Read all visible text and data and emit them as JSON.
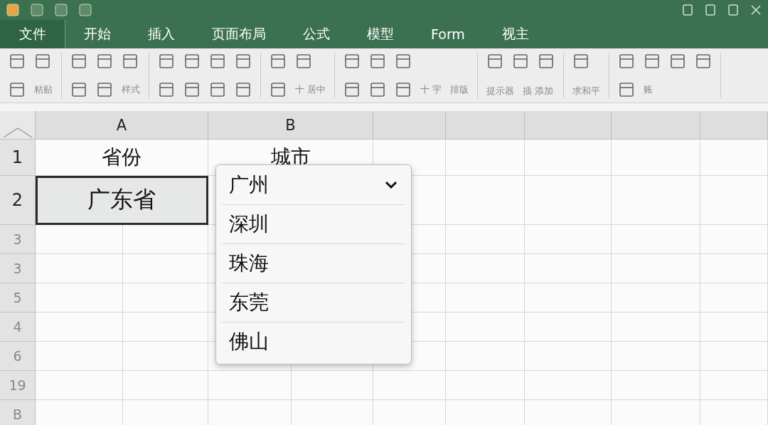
{
  "menu_tabs": [
    {
      "label": "文件",
      "selected": true
    },
    {
      "label": "开始",
      "selected": false
    },
    {
      "label": "插入",
      "selected": false
    },
    {
      "label": "页面布局",
      "selected": false
    },
    {
      "label": "公式",
      "selected": false
    },
    {
      "label": "模型",
      "selected": false
    },
    {
      "label": "Form",
      "selected": false
    },
    {
      "label": "视主",
      "selected": false
    }
  ],
  "ribbon_groups": [
    {
      "kind": "labeled",
      "labels": [
        "粘贴"
      ]
    },
    {
      "kind": "labeled",
      "labels": [
        "样式"
      ]
    },
    {
      "kind": "grid"
    },
    {
      "kind": "labeled",
      "labels": [
        "十 居中"
      ]
    },
    {
      "kind": "labeled",
      "labels": [
        "十 宇",
        "排版"
      ]
    },
    {
      "kind": "labeled",
      "labels": [
        "提示器",
        "插 添加"
      ]
    },
    {
      "kind": "labeled",
      "labels": [
        "求和平"
      ]
    },
    {
      "kind": "labeled",
      "labels": [
        "账"
      ]
    }
  ],
  "sheet": {
    "columns": [
      "A",
      "B"
    ],
    "rows": [
      {
        "header": "1",
        "cells": [
          {
            "text": "省份",
            "selected": false
          },
          {
            "text": "城市",
            "selected": false
          }
        ]
      },
      {
        "header": "2",
        "cells": [
          {
            "text": "广东省",
            "selected": true
          }
        ]
      },
      {
        "header": "3"
      },
      {
        "header": "3"
      },
      {
        "header": "5"
      },
      {
        "header": "4"
      },
      {
        "header": "6"
      },
      {
        "header": "19"
      },
      {
        "header": "B"
      }
    ]
  },
  "dropdown": {
    "value": "广州",
    "options": [
      "深圳",
      "珠海",
      "东莞",
      "佛山"
    ]
  }
}
